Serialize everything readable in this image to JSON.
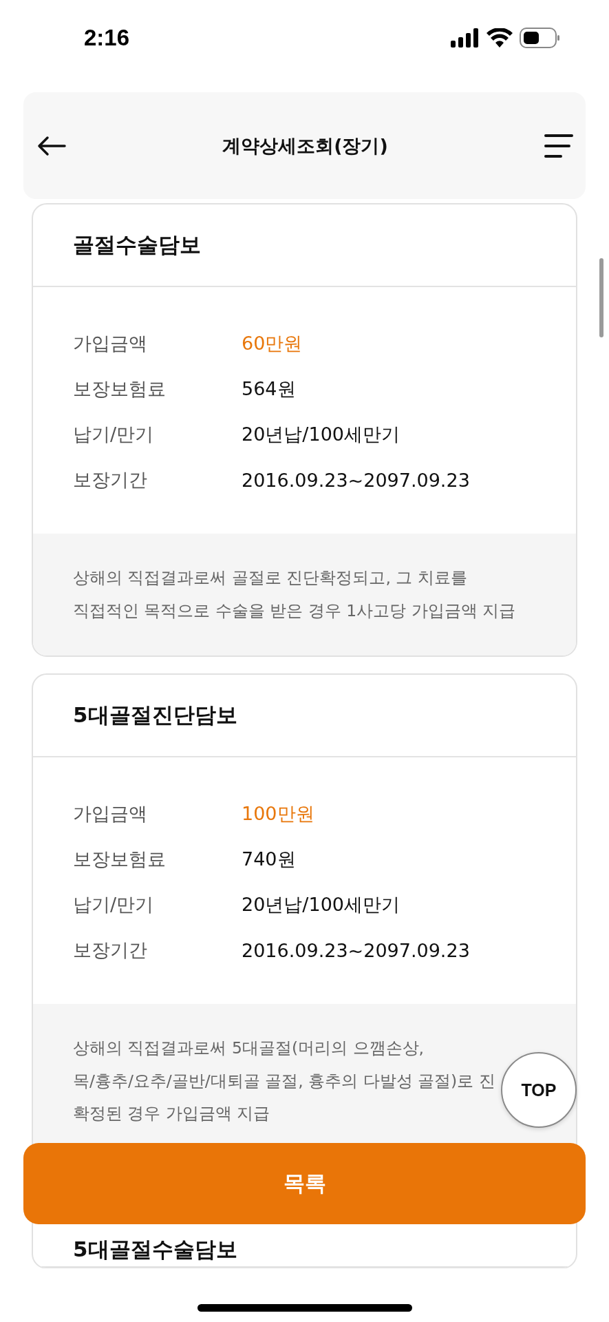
{
  "status_bar": {
    "time": "2:16"
  },
  "header": {
    "title": "계약상세조회(장기)"
  },
  "cards": [
    {
      "title": "골절수술담보",
      "rows": [
        {
          "label": "가입금액",
          "value": "60만원",
          "highlight": true
        },
        {
          "label": "보장보험료",
          "value": "564원",
          "highlight": false
        },
        {
          "label": "납기/만기",
          "value": "20년납/100세만기",
          "highlight": false
        },
        {
          "label": "보장기간",
          "value": "2016.09.23~2097.09.23",
          "highlight": false
        }
      ],
      "description": [
        "상해의 직접결과로써 골절로 진단확정되고, 그 치료를",
        "직접적인 목적으로 수술을 받은 경우 1사고당 가입금액 지급"
      ]
    },
    {
      "title": "5대골절진단담보",
      "rows": [
        {
          "label": "가입금액",
          "value": "100만원",
          "highlight": true
        },
        {
          "label": "보장보험료",
          "value": "740원",
          "highlight": false
        },
        {
          "label": "납기/만기",
          "value": "20년납/100세만기",
          "highlight": false
        },
        {
          "label": "보장기간",
          "value": "2016.09.23~2097.09.23",
          "highlight": false
        }
      ],
      "description": [
        "상해의 직접결과로써 5대골절(머리의 으깸손상,",
        "목/흉추/요추/골반/대퇴골 골절, 흉추의 다발성 골절)로 진",
        "확정된 경우 가입금액 지급"
      ]
    },
    {
      "title": "5대골절수술담보"
    }
  ],
  "top_button": "TOP",
  "list_button": "목록"
}
